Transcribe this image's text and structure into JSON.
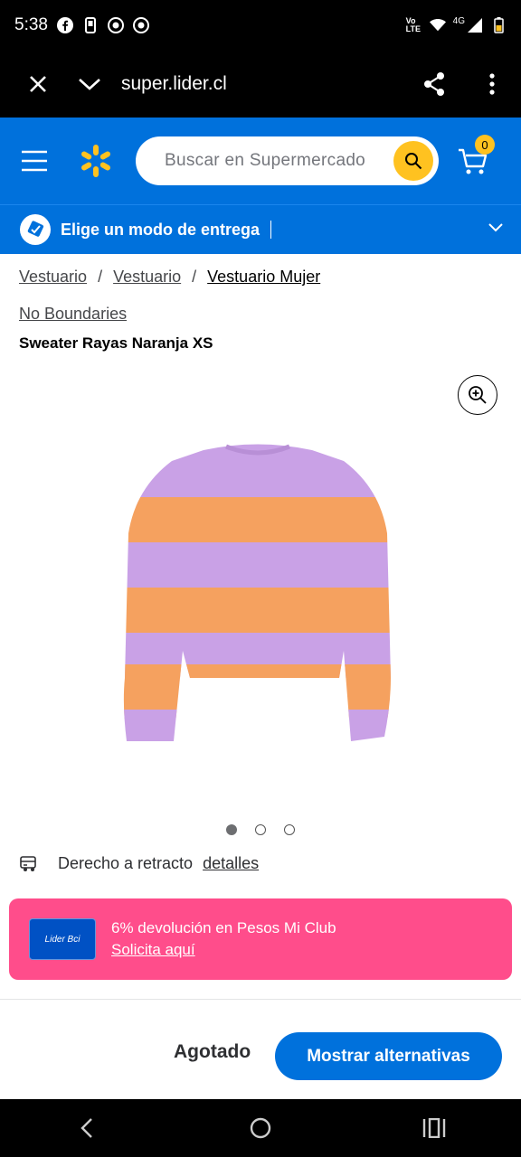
{
  "status_bar": {
    "time": "5:38",
    "icons_left": [
      "facebook-icon",
      "phone-icon",
      "chrome-icon",
      "chrome-icon"
    ],
    "icons_right": [
      "volte-icon",
      "wifi-icon",
      "4g-signal-icon",
      "battery-icon"
    ],
    "volte_text": "Vo LTE",
    "network_text": "4G"
  },
  "browser": {
    "url": "super.lider.cl",
    "close_icon": "close-icon",
    "expand_icon": "chevron-down-icon",
    "share_icon": "share-icon",
    "more_icon": "more-vert-icon"
  },
  "header": {
    "search_placeholder": "Buscar en Supermercado",
    "cart_count": "0",
    "colors": {
      "brand_blue": "#0071dc",
      "spark_yellow": "#ffc220"
    }
  },
  "delivery": {
    "label": "Elige un modo de entrega"
  },
  "breadcrumb": {
    "items": [
      "Vestuario",
      "Vestuario",
      "Vestuario Mujer"
    ],
    "separator": "/"
  },
  "product": {
    "brand": "No Boundaries",
    "title": "Sweater Rayas Naranja XS",
    "image_count": 3,
    "active_image_index": 0
  },
  "retracto": {
    "label": "Derecho a retracto",
    "link": "detalles"
  },
  "promo": {
    "card_label": "Lider Bci",
    "text": "6% devolución en Pesos Mi Club",
    "link": "Solicita aquí",
    "color": "#ff4d8b"
  },
  "footer": {
    "status": "Agotado",
    "button": "Mostrar alternativas"
  },
  "nav": {
    "icons": [
      "back-icon",
      "home-icon",
      "recents-icon"
    ]
  }
}
